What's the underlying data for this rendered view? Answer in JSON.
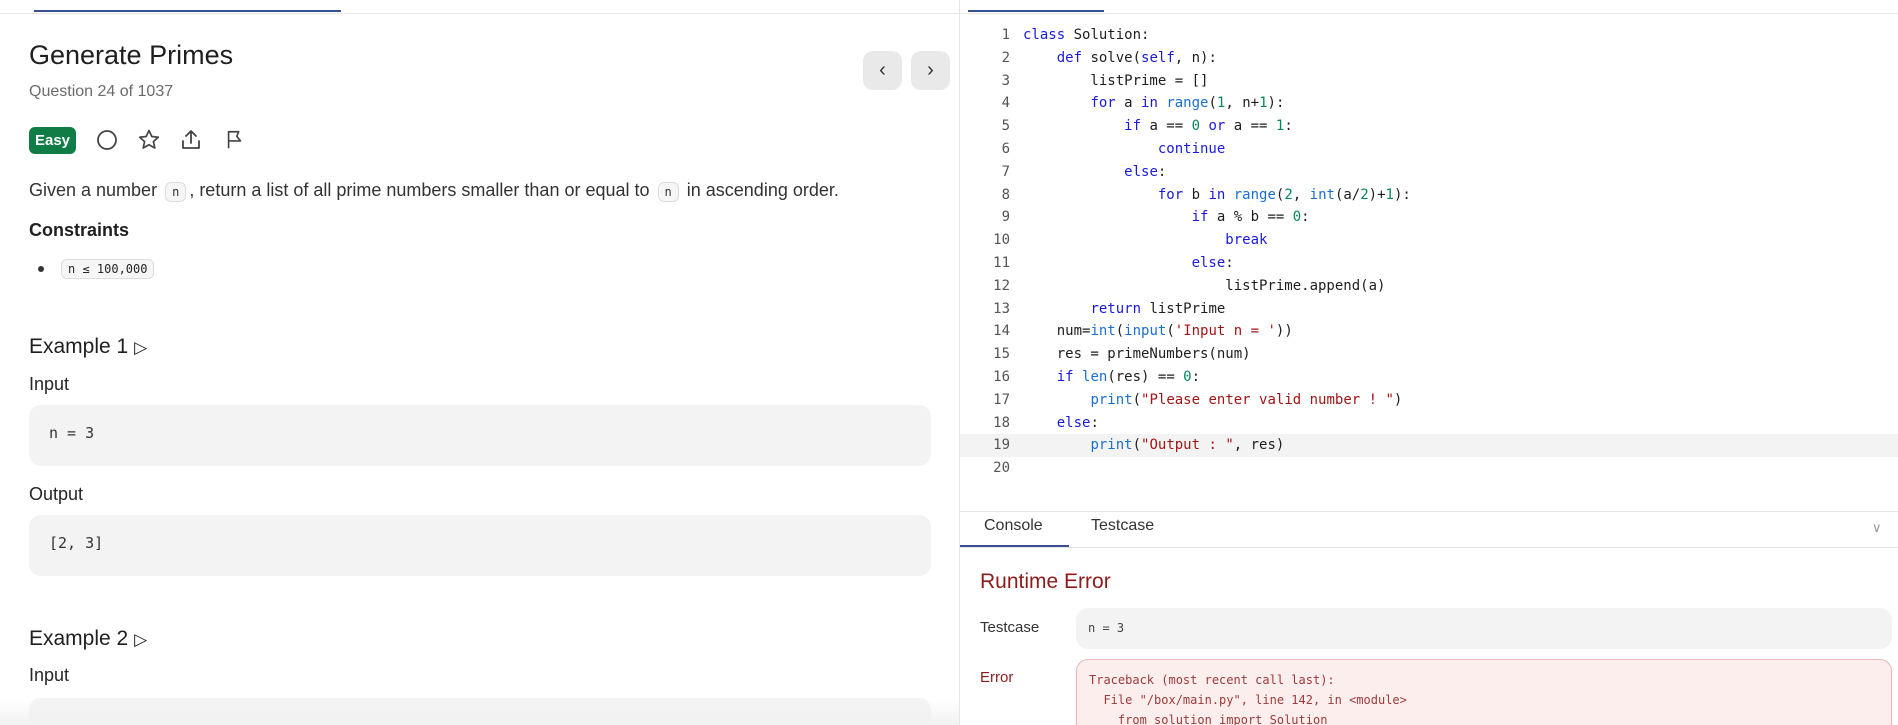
{
  "problem": {
    "title": "Generate Primes",
    "subtitle": "Question 24 of 1037",
    "difficulty": "Easy",
    "difficulty_color": "#0f7d45",
    "desc_parts": [
      "Given a number ",
      "n",
      ", return a list of all prime numbers smaller than or equal to ",
      "n",
      " in ascending order."
    ],
    "constraints_heading": "Constraints",
    "constraints": [
      "n ≤ 100,000"
    ],
    "examples": [
      {
        "title": "Example 1",
        "input_label": "Input",
        "input": "n = 3",
        "output_label": "Output",
        "output": "[2, 3]"
      },
      {
        "title": "Example 2",
        "input_label": "Input"
      }
    ],
    "icons": {
      "prev": "‹",
      "next": "›",
      "play": "▷"
    }
  },
  "editor": {
    "lines": [
      [
        [
          "class",
          "kw"
        ],
        [
          " Solution:",
          ""
        ]
      ],
      [
        [
          "    ",
          ""
        ],
        [
          "def",
          "kw"
        ],
        [
          " solve(",
          ""
        ],
        [
          "self",
          "kw"
        ],
        [
          ", n):",
          ""
        ]
      ],
      [
        [
          "        listPrime = []",
          ""
        ]
      ],
      [
        [
          "        ",
          ""
        ],
        [
          "for",
          "kw"
        ],
        [
          " a ",
          ""
        ],
        [
          "in",
          "kw"
        ],
        [
          " ",
          ""
        ],
        [
          "range",
          "bi"
        ],
        [
          "(",
          ""
        ],
        [
          "1",
          "num"
        ],
        [
          ", n+",
          ""
        ],
        [
          "1",
          "num"
        ],
        [
          "):",
          ""
        ]
      ],
      [
        [
          "            ",
          ""
        ],
        [
          "if",
          "kw"
        ],
        [
          " a == ",
          ""
        ],
        [
          "0",
          "num"
        ],
        [
          " ",
          ""
        ],
        [
          "or",
          "kw"
        ],
        [
          " a == ",
          ""
        ],
        [
          "1",
          "num"
        ],
        [
          ":",
          ""
        ]
      ],
      [
        [
          "                ",
          ""
        ],
        [
          "continue",
          "kw"
        ]
      ],
      [
        [
          "            ",
          ""
        ],
        [
          "else",
          "kw"
        ],
        [
          ":",
          ""
        ]
      ],
      [
        [
          "                ",
          ""
        ],
        [
          "for",
          "kw"
        ],
        [
          " b ",
          ""
        ],
        [
          "in",
          "kw"
        ],
        [
          " ",
          ""
        ],
        [
          "range",
          "bi"
        ],
        [
          "(",
          ""
        ],
        [
          "2",
          "num"
        ],
        [
          ", ",
          ""
        ],
        [
          "int",
          "bi"
        ],
        [
          "(a/",
          ""
        ],
        [
          "2",
          "num"
        ],
        [
          ")+",
          ""
        ],
        [
          "1",
          "num"
        ],
        [
          "):",
          ""
        ]
      ],
      [
        [
          "                    ",
          ""
        ],
        [
          "if",
          "kw"
        ],
        [
          " a % b == ",
          ""
        ],
        [
          "0",
          "num"
        ],
        [
          ":",
          ""
        ]
      ],
      [
        [
          "                        ",
          ""
        ],
        [
          "break",
          "kw"
        ]
      ],
      [
        [
          "                    ",
          ""
        ],
        [
          "else",
          "kw"
        ],
        [
          ":",
          ""
        ]
      ],
      [
        [
          "                        listPrime.append(a)",
          ""
        ]
      ],
      [
        [
          "        ",
          ""
        ],
        [
          "return",
          "kw"
        ],
        [
          " listPrime",
          ""
        ]
      ],
      [
        [
          "    num=",
          ""
        ],
        [
          "int",
          "bi"
        ],
        [
          "(",
          ""
        ],
        [
          "input",
          "bi"
        ],
        [
          "(",
          ""
        ],
        [
          "'Input n = '",
          "str"
        ],
        [
          "))",
          ""
        ]
      ],
      [
        [
          "    res = primeNumbers(num)",
          ""
        ]
      ],
      [
        [
          "    ",
          ""
        ],
        [
          "if",
          "kw"
        ],
        [
          " ",
          ""
        ],
        [
          "len",
          "bi"
        ],
        [
          "(res) == ",
          ""
        ],
        [
          "0",
          "num"
        ],
        [
          ":",
          ""
        ]
      ],
      [
        [
          "        ",
          ""
        ],
        [
          "print",
          "bi"
        ],
        [
          "(",
          ""
        ],
        [
          "\"Please enter valid number ! \"",
          "str"
        ],
        [
          ")",
          ""
        ]
      ],
      [
        [
          "    ",
          ""
        ],
        [
          "else",
          "kw"
        ],
        [
          ":",
          ""
        ]
      ],
      [
        [
          "        ",
          ""
        ],
        [
          "print",
          "bi"
        ],
        [
          "(",
          ""
        ],
        [
          "\"Output : \"",
          "str"
        ],
        [
          ", res)",
          ""
        ]
      ],
      []
    ],
    "highlighted_line": 19
  },
  "console": {
    "tabs": [
      "Console",
      "Testcase"
    ],
    "status": "Runtime Error",
    "testcase_label": "Testcase",
    "testcase": "n = 3",
    "error_label": "Error",
    "error_lines": [
      "Traceback (most recent call last):",
      "  File \"/box/main.py\", line 142, in <module>",
      "    from solution import Solution"
    ]
  }
}
